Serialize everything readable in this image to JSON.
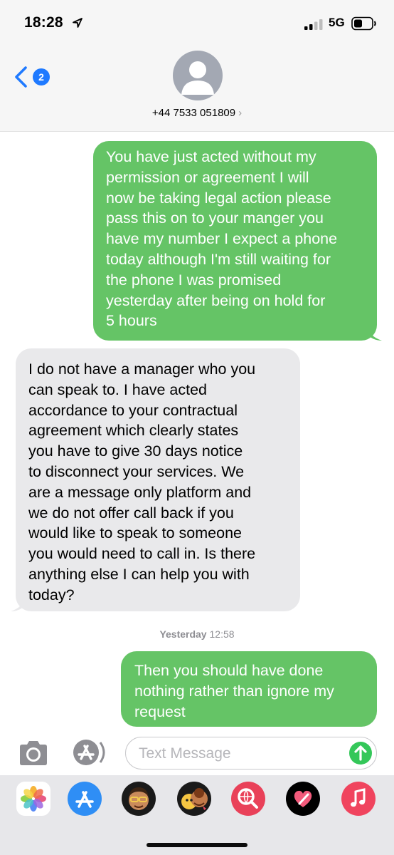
{
  "status_bar": {
    "time": "18:28",
    "network": "5G"
  },
  "header": {
    "back_badge": "2",
    "contact": "+44 7533 051809"
  },
  "messages": [
    {
      "type": "sent",
      "lines": [
        "You have just acted without my",
        "permission or agreement I will",
        "now be taking legal action please",
        "pass this on to your manger you",
        "have my number I expect a phone",
        "today although I'm still waiting for",
        "the phone I was promised",
        "yesterday after being on hold for",
        "5 hours"
      ]
    },
    {
      "type": "received",
      "lines": [
        "I do not have a manager who you",
        "can speak to. I have acted",
        "accordance to your contractual",
        "agreement which clearly states",
        "you have to give 30 days notice",
        "to disconnect your services. We",
        "are a message only platform and",
        "we do not offer call back if you",
        "would like to speak to someone",
        "you would need to call in. Is there",
        "anything else I can help you with",
        "today?"
      ]
    },
    {
      "type": "sent",
      "lines": [
        "Then you should have done",
        "nothing rather than ignore my",
        "request"
      ]
    }
  ],
  "timestamp": {
    "day": "Yesterday",
    "time": "12:58"
  },
  "input": {
    "placeholder": "Text Message"
  },
  "apps": [
    "photos-icon",
    "app-store-icon",
    "memoji-icon",
    "animoji-icon",
    "web-search-icon",
    "digital-touch-icon",
    "music-icon"
  ],
  "colors": {
    "sent_bubble": "#65c466",
    "received_bubble": "#e9e9eb",
    "accent": "#1f7aff",
    "send_button": "#34c759"
  }
}
